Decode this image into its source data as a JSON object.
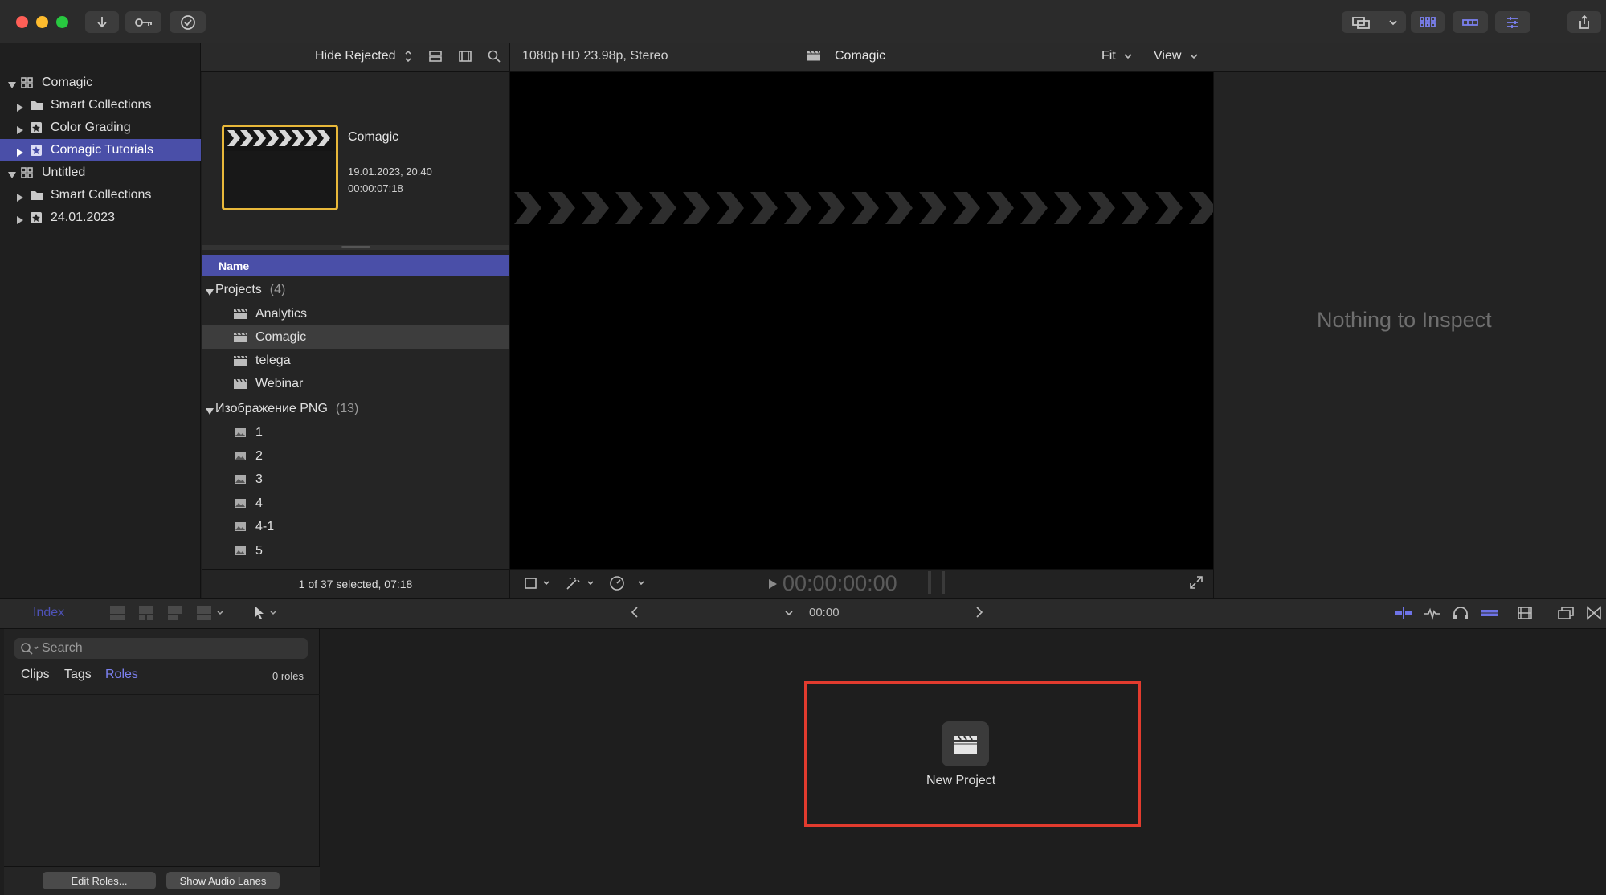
{
  "window": {
    "traffic_colors": {
      "close": "#ff5f57",
      "minimize": "#febc2e",
      "maximize": "#28c840"
    }
  },
  "titlebar": {
    "icons": [
      "import-icon",
      "keywords-icon",
      "background-tasks-icon",
      "display-icon",
      "browser-view-icon",
      "timeline-view-icon",
      "inspector-view-icon",
      "share-icon"
    ]
  },
  "library_toolbar": {
    "filter_label": "Hide Rejected"
  },
  "libraries": [
    {
      "label": "Comagic",
      "level": 0,
      "expanded": true,
      "kind": "library"
    },
    {
      "label": "Smart Collections",
      "level": 1,
      "kind": "folder"
    },
    {
      "label": "Color Grading",
      "level": 1,
      "kind": "event"
    },
    {
      "label": "Comagic Tutorials",
      "level": 1,
      "kind": "event",
      "selected": true
    },
    {
      "label": "Untitled",
      "level": 0,
      "expanded": true,
      "kind": "library"
    },
    {
      "label": "Smart Collections",
      "level": 1,
      "kind": "folder"
    },
    {
      "label": "24.01.2023",
      "level": 1,
      "kind": "event"
    }
  ],
  "clip_preview": {
    "title": "Comagic",
    "date": "19.01.2023, 20:40",
    "duration": "00:00:07:18"
  },
  "browser": {
    "column_header": "Name",
    "groups": [
      {
        "label": "Projects",
        "count": "(4)",
        "items": [
          "Analytics",
          "Comagic",
          "telega",
          "Webinar"
        ],
        "icon": "project-icon"
      },
      {
        "label": "Изображение PNG",
        "count": "(13)",
        "items": [
          "1",
          "2",
          "3",
          "4",
          "4-1",
          "5"
        ],
        "icon": "image-icon"
      }
    ],
    "selected_item": "Comagic",
    "footer": "1 of 37 selected, 07:18"
  },
  "viewer": {
    "format": "1080p HD 23.98p, Stereo",
    "title": "Comagic",
    "fit_label": "Fit",
    "view_label": "View",
    "timecode": "00:00:00:00"
  },
  "inspector": {
    "empty_text": "Nothing to Inspect"
  },
  "timeline_toolbar": {
    "index_label": "Index",
    "timecode": "00:00"
  },
  "index": {
    "search_placeholder": "Search",
    "tabs": [
      "Clips",
      "Tags",
      "Roles"
    ],
    "active_tab": "Roles",
    "roles_count": "0 roles",
    "edit_roles": "Edit Roles...",
    "show_audio_lanes": "Show Audio Lanes"
  },
  "timeline": {
    "new_project_label": "New Project"
  },
  "colors": {
    "selection": "#4a4fa8",
    "highlight_box": "#e23b2e",
    "clip_border": "#e8b83a",
    "accent_blue": "#6e73e6"
  }
}
